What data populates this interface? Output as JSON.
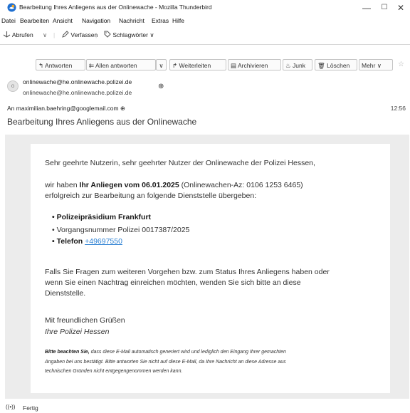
{
  "window": {
    "title": "Bearbeitung Ihres Anliegens aus der Onlinewache - Mozilla Thunderbird",
    "minimize_glyph": "—",
    "maximize_glyph": "☐",
    "close_glyph": "✕"
  },
  "menu": {
    "items": [
      "Datei",
      "Bearbeiten",
      "Ansicht",
      "Navigation",
      "Nachricht",
      "Extras",
      "Hilfe"
    ]
  },
  "toolbar": {
    "get_messages": "Abrufen",
    "compose": "Verfassen",
    "tags": "Schlagwörter"
  },
  "message_actions": {
    "reply": "Antworten",
    "reply_all": "Allen antworten",
    "forward": "Weiterleiten",
    "archive": "Archivieren",
    "junk": "Junk",
    "delete": "Löschen",
    "more": "Mehr"
  },
  "header": {
    "from_name": "onlinewache@he.onlinewache.polizei.de",
    "from_email": "onlinewache@he.onlinewache.polizei.de",
    "to_label": "An",
    "to_address": "maximilian.baehring@googlemail.com",
    "time": "12:56",
    "subject": "Bearbeitung Ihres Anliegens aus der Onlinewache"
  },
  "body": {
    "greeting": "Sehr geehrte Nutzerin, sehr geehrter Nutzer der Onlinewache der Polizei Hessen,",
    "p1_prefix": "wir haben ",
    "p1_bold": "Ihr Anliegen vom 06.01.2025",
    "p1_suffix": " (Onlinewachen-Az: 0106 1253 6465)",
    "p1_line2": "erfolgreich zur Bearbeitung an folgende Dienststelle übergeben:",
    "bullet1": "Polizeipräsidium Frankfurt",
    "bullet2": "Vorgangsnummer Polizei 0017387/2025",
    "bullet3_label": "Telefon",
    "bullet3_link": "+49697550",
    "p2_line1": "Falls Sie Fragen zum weiteren Vorgehen bzw. zum Status Ihres Anliegens haben oder",
    "p2_line2": "wenn Sie einen Nachtrag einreichen möchten, wenden Sie sich bitte an diese",
    "p2_line3": "Dienststelle.",
    "closing1": "Mit freundlichen Grüßen",
    "closing2": "Ihre Polizei Hessen",
    "disclaimer_bold": "Bitte beachten Sie,",
    "disclaimer_line1": " dass diese E-Mail automatisch generiert wird und lediglich den Eingang Ihrer gemachten",
    "disclaimer_line2": "Angaben bei uns bestätigt. Bitte antworten Sie nicht auf diese E-Mail, da Ihre Nachricht an diese Adresse aus",
    "disclaimer_line3": "technischen Gründen nicht entgegengenommen werden kann."
  },
  "status": {
    "text": "Fertig"
  },
  "colors": {
    "link": "#2a7fd2",
    "thunderbird_blue": "#1f6fd0"
  }
}
